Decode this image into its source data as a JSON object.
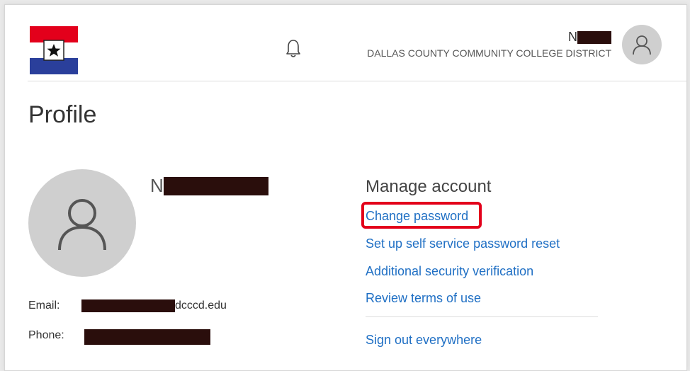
{
  "header": {
    "user_name_initial": "N",
    "org_name": "DALLAS COUNTY COMMUNITY COLLEGE DISTRICT"
  },
  "page": {
    "title": "Profile"
  },
  "profile": {
    "name_initial": "N",
    "email_label": "Email:",
    "email_suffix": "dcccd.edu",
    "phone_label": "Phone:"
  },
  "manage": {
    "title": "Manage account",
    "links": [
      "Change password",
      "Set up self service password reset",
      "Additional security verification",
      "Review terms of use",
      "Sign out everywhere"
    ]
  },
  "colors": {
    "link": "#1f6fc4",
    "highlight": "#e3001b",
    "flag_red": "#e3001b",
    "flag_blue": "#2a3f9b",
    "redaction": "#2a0e0c"
  },
  "icons": [
    "flag-logo-icon",
    "bell-icon",
    "user-avatar-icon"
  ]
}
